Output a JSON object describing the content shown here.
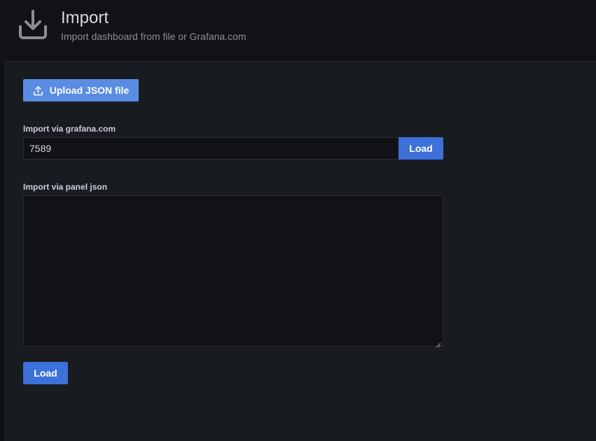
{
  "header": {
    "icon": "download-icon",
    "title": "Import",
    "subtitle": "Import dashboard from file or Grafana.com"
  },
  "upload": {
    "icon": "upload-icon",
    "label": "Upload JSON file"
  },
  "grafana_import": {
    "label": "Import via grafana.com",
    "value": "7589",
    "button_label": "Load"
  },
  "json_import": {
    "label": "Import via panel json",
    "value": ""
  },
  "load_button": {
    "label": "Load"
  },
  "colors": {
    "background": "#111217",
    "panel": "#181b1f",
    "primary": "#3d71d9",
    "upload_button": "#5b8ce3",
    "text": "#d8d9da",
    "muted_text": "#8e8e8e"
  }
}
